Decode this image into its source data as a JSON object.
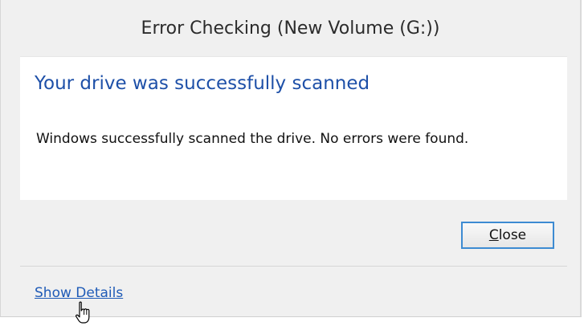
{
  "window": {
    "title": "Error Checking (New Volume (G:))"
  },
  "content": {
    "heading": "Your drive was successfully scanned",
    "message": "Windows successfully scanned the drive. No errors were found."
  },
  "buttons": {
    "close_mnemonic": "C",
    "close_rest": "lose"
  },
  "footer": {
    "details_link": "Show Details"
  },
  "cursor": {
    "icon": "hand-pointer-icon"
  },
  "colors": {
    "heading": "#1e50a8",
    "link": "#1f5bb7",
    "button_focus_border": "#3d8bd2"
  }
}
